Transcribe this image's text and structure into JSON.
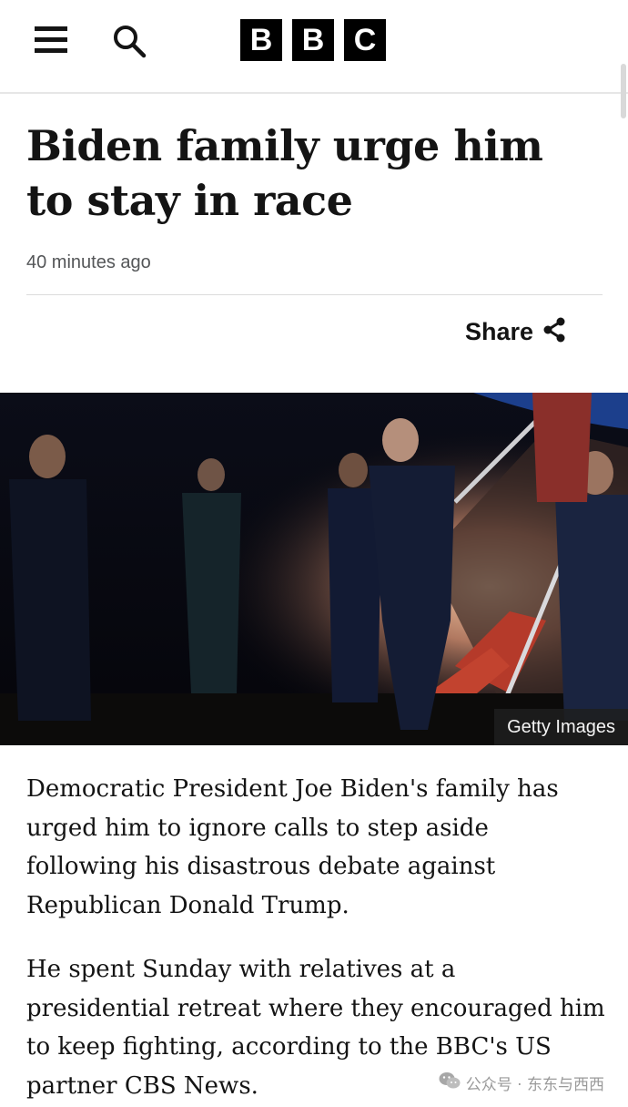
{
  "header": {
    "menu_icon": "hamburger-menu-icon",
    "search_icon": "search-icon",
    "logo_letters": [
      "B",
      "B",
      "C"
    ]
  },
  "article": {
    "headline": "Biden family urge him to stay in race",
    "timestamp": "40 minutes ago",
    "share_label": "Share",
    "share_icon": "share-icon",
    "image_credit": "Getty Images",
    "paragraphs": [
      "Democratic President Joe Biden's family has urged him to ignore calls to step aside following his disastrous debate against Republican Donald Trump.",
      "He spent Sunday with relatives at a presidential retreat where they encouraged him to keep fighting, according to the BBC's US partner CBS News."
    ]
  },
  "watermark": {
    "text": "公众号 · 东东与西西",
    "icon": "wechat-icon"
  },
  "colors": {
    "logo_bg": "#000000",
    "text": "#141414",
    "meta": "#545658"
  }
}
